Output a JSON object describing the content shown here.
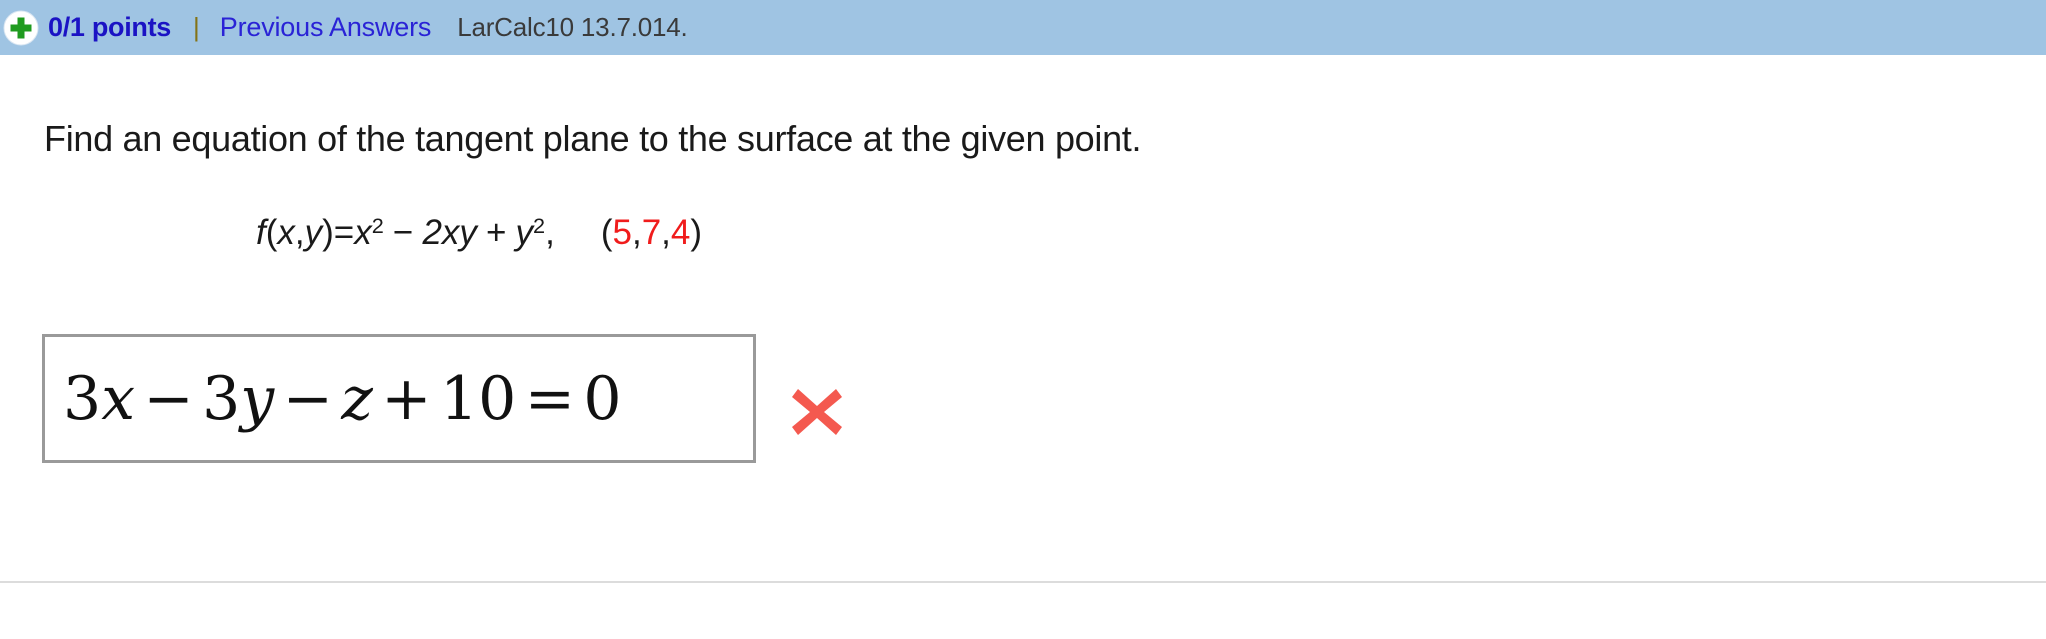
{
  "header": {
    "status_icon": "green-plus-circle-icon",
    "points": "0/1 points",
    "separator": "|",
    "previous_answers_link": "Previous Answers",
    "problem_code": "LarCalc10 13.7.014.",
    "background_color": "#9fc4e3",
    "points_color": "#1b13c4",
    "link_color": "#2a23d6"
  },
  "question": {
    "prompt": "Find an equation of the tangent plane to the surface at the given point."
  },
  "formula": {
    "function_name": "f",
    "args_open": "(",
    "arg1": "x",
    "arg_comma": ", ",
    "arg2": "y",
    "args_close": ")",
    "equals": " = ",
    "term1_base": "x",
    "term1_exp": "2",
    "minus": "−",
    "term2": "2xy",
    "plus": "+",
    "term3_base": "y",
    "term3_exp": "2",
    "trailing_comma": ",",
    "point_open": "(",
    "point_x": "5",
    "point_sep1": ", ",
    "point_y": "7",
    "point_sep2": ", ",
    "point_z": "4",
    "point_close": ")",
    "point_color": "#f01c1c"
  },
  "answer": {
    "coef_x": "3",
    "var_x": "x",
    "op1": "−",
    "coef_y": "3",
    "var_y": "y",
    "op2": "−",
    "var_z": "z",
    "op3": "+",
    "constant": "10",
    "equals": "=",
    "rhs": "0",
    "full_text": "3x − 3y − z + 10 = 0",
    "result_icon": "red-x-incorrect-icon",
    "result_color": "#f4594f",
    "border_color": "#9a9a9a"
  }
}
